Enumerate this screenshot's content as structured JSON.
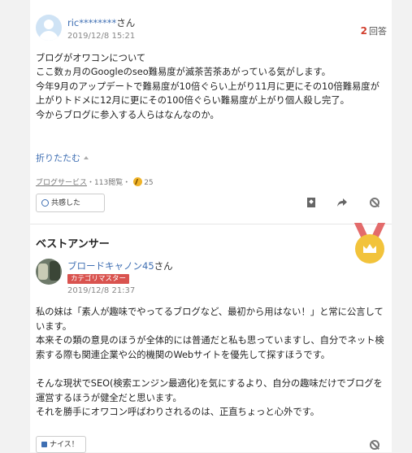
{
  "question": {
    "username": "ric********",
    "honorific": "さん",
    "date": "2019/12/8 15:21",
    "answer_count": "2",
    "answer_count_suffix": "回答",
    "body": [
      "ブログがオワコンについて",
      "ここ数ヵ月のGoogleのseo難易度が滅茶苦茶あがっている気がします。",
      "今年9月のアップデートで難易度が10倍ぐらい上がり11月に更にその10倍難易度が上がりトドメに12月に更にその100倍ぐらい難易度が上がり個人殺し完了。",
      "今からブログに参入する人らはなんなのか。"
    ],
    "fold_label": "折りたたむ",
    "category": "ブログサービス",
    "views": "・113閲覧・",
    "coins": "25",
    "kyokan_label": "共感した"
  },
  "best_answer": {
    "heading": "ベストアンサー",
    "username": "ブロードキャノン45",
    "honorific": "さん",
    "badge": "カテゴリマスター",
    "date": "2019/12/8 21:37",
    "body": [
      "私の妹は「素人が趣味でやってるブログなど、最初から用はない！」と常に公言しています。",
      "本来その類の意見のほうが全体的には普通だと私も思っていますし、自分でネット検索する際も関連企業や公的機関のWebサイトを優先して探すほうです。",
      "",
      "そんな現状でSEO(検索エンジン最適化)を気にするより、自分の趣味だけでブログを運営するほうが健全だと思います。",
      "それを勝手にオワコン呼ばわりされるのは、正直ちょっと心外です。"
    ],
    "nice_label": "ナイス！"
  },
  "colors": {
    "link": "#3f6fb3",
    "accent": "#d2402f",
    "medal": "#f2c33b"
  }
}
